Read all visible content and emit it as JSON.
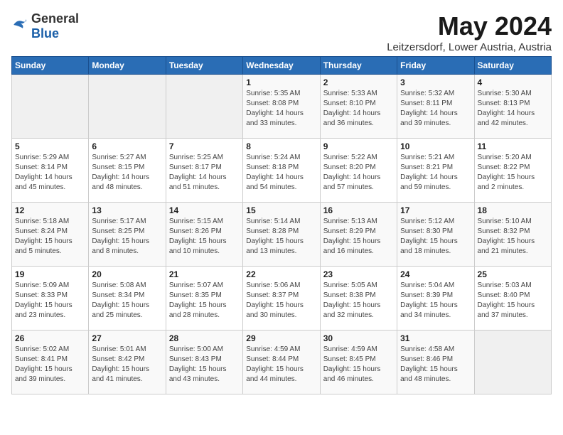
{
  "logo": {
    "general": "General",
    "blue": "Blue"
  },
  "title": "May 2024",
  "subtitle": "Leitzersdorf, Lower Austria, Austria",
  "days_of_week": [
    "Sunday",
    "Monday",
    "Tuesday",
    "Wednesday",
    "Thursday",
    "Friday",
    "Saturday"
  ],
  "weeks": [
    [
      {
        "day": "",
        "info": ""
      },
      {
        "day": "",
        "info": ""
      },
      {
        "day": "",
        "info": ""
      },
      {
        "day": "1",
        "info": "Sunrise: 5:35 AM\nSunset: 8:08 PM\nDaylight: 14 hours\nand 33 minutes."
      },
      {
        "day": "2",
        "info": "Sunrise: 5:33 AM\nSunset: 8:10 PM\nDaylight: 14 hours\nand 36 minutes."
      },
      {
        "day": "3",
        "info": "Sunrise: 5:32 AM\nSunset: 8:11 PM\nDaylight: 14 hours\nand 39 minutes."
      },
      {
        "day": "4",
        "info": "Sunrise: 5:30 AM\nSunset: 8:13 PM\nDaylight: 14 hours\nand 42 minutes."
      }
    ],
    [
      {
        "day": "5",
        "info": "Sunrise: 5:29 AM\nSunset: 8:14 PM\nDaylight: 14 hours\nand 45 minutes."
      },
      {
        "day": "6",
        "info": "Sunrise: 5:27 AM\nSunset: 8:15 PM\nDaylight: 14 hours\nand 48 minutes."
      },
      {
        "day": "7",
        "info": "Sunrise: 5:25 AM\nSunset: 8:17 PM\nDaylight: 14 hours\nand 51 minutes."
      },
      {
        "day": "8",
        "info": "Sunrise: 5:24 AM\nSunset: 8:18 PM\nDaylight: 14 hours\nand 54 minutes."
      },
      {
        "day": "9",
        "info": "Sunrise: 5:22 AM\nSunset: 8:20 PM\nDaylight: 14 hours\nand 57 minutes."
      },
      {
        "day": "10",
        "info": "Sunrise: 5:21 AM\nSunset: 8:21 PM\nDaylight: 14 hours\nand 59 minutes."
      },
      {
        "day": "11",
        "info": "Sunrise: 5:20 AM\nSunset: 8:22 PM\nDaylight: 15 hours\nand 2 minutes."
      }
    ],
    [
      {
        "day": "12",
        "info": "Sunrise: 5:18 AM\nSunset: 8:24 PM\nDaylight: 15 hours\nand 5 minutes."
      },
      {
        "day": "13",
        "info": "Sunrise: 5:17 AM\nSunset: 8:25 PM\nDaylight: 15 hours\nand 8 minutes."
      },
      {
        "day": "14",
        "info": "Sunrise: 5:15 AM\nSunset: 8:26 PM\nDaylight: 15 hours\nand 10 minutes."
      },
      {
        "day": "15",
        "info": "Sunrise: 5:14 AM\nSunset: 8:28 PM\nDaylight: 15 hours\nand 13 minutes."
      },
      {
        "day": "16",
        "info": "Sunrise: 5:13 AM\nSunset: 8:29 PM\nDaylight: 15 hours\nand 16 minutes."
      },
      {
        "day": "17",
        "info": "Sunrise: 5:12 AM\nSunset: 8:30 PM\nDaylight: 15 hours\nand 18 minutes."
      },
      {
        "day": "18",
        "info": "Sunrise: 5:10 AM\nSunset: 8:32 PM\nDaylight: 15 hours\nand 21 minutes."
      }
    ],
    [
      {
        "day": "19",
        "info": "Sunrise: 5:09 AM\nSunset: 8:33 PM\nDaylight: 15 hours\nand 23 minutes."
      },
      {
        "day": "20",
        "info": "Sunrise: 5:08 AM\nSunset: 8:34 PM\nDaylight: 15 hours\nand 25 minutes."
      },
      {
        "day": "21",
        "info": "Sunrise: 5:07 AM\nSunset: 8:35 PM\nDaylight: 15 hours\nand 28 minutes."
      },
      {
        "day": "22",
        "info": "Sunrise: 5:06 AM\nSunset: 8:37 PM\nDaylight: 15 hours\nand 30 minutes."
      },
      {
        "day": "23",
        "info": "Sunrise: 5:05 AM\nSunset: 8:38 PM\nDaylight: 15 hours\nand 32 minutes."
      },
      {
        "day": "24",
        "info": "Sunrise: 5:04 AM\nSunset: 8:39 PM\nDaylight: 15 hours\nand 34 minutes."
      },
      {
        "day": "25",
        "info": "Sunrise: 5:03 AM\nSunset: 8:40 PM\nDaylight: 15 hours\nand 37 minutes."
      }
    ],
    [
      {
        "day": "26",
        "info": "Sunrise: 5:02 AM\nSunset: 8:41 PM\nDaylight: 15 hours\nand 39 minutes."
      },
      {
        "day": "27",
        "info": "Sunrise: 5:01 AM\nSunset: 8:42 PM\nDaylight: 15 hours\nand 41 minutes."
      },
      {
        "day": "28",
        "info": "Sunrise: 5:00 AM\nSunset: 8:43 PM\nDaylight: 15 hours\nand 43 minutes."
      },
      {
        "day": "29",
        "info": "Sunrise: 4:59 AM\nSunset: 8:44 PM\nDaylight: 15 hours\nand 44 minutes."
      },
      {
        "day": "30",
        "info": "Sunrise: 4:59 AM\nSunset: 8:45 PM\nDaylight: 15 hours\nand 46 minutes."
      },
      {
        "day": "31",
        "info": "Sunrise: 4:58 AM\nSunset: 8:46 PM\nDaylight: 15 hours\nand 48 minutes."
      },
      {
        "day": "",
        "info": ""
      }
    ]
  ]
}
